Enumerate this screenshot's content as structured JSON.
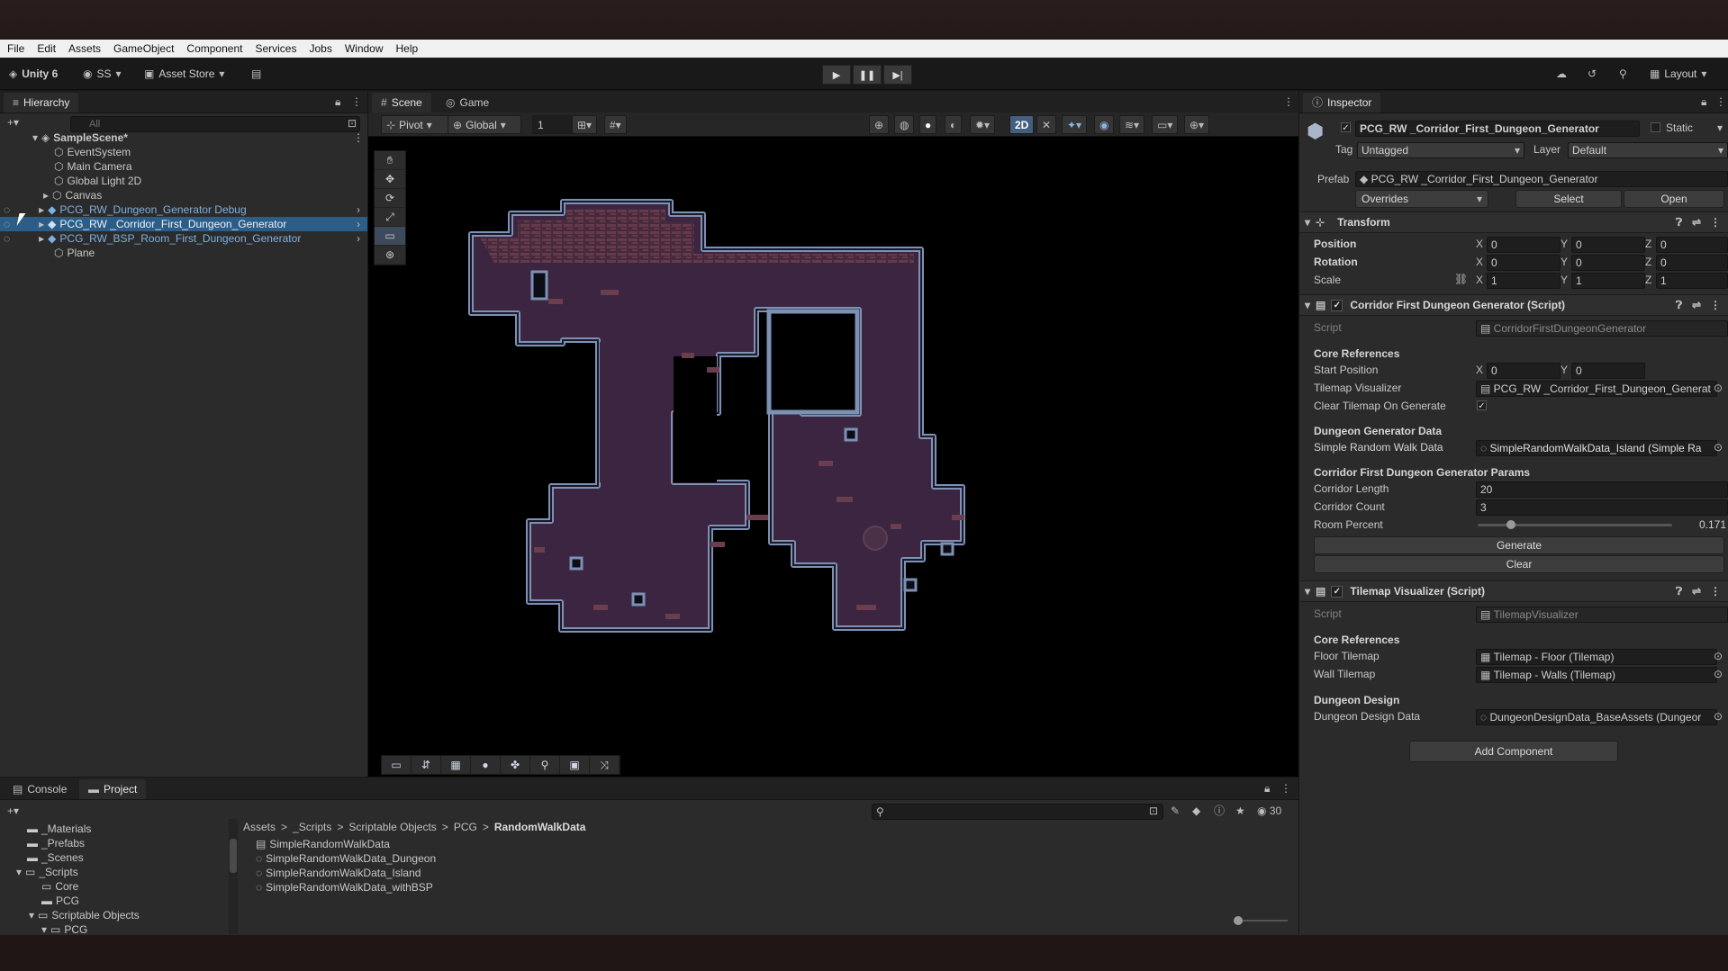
{
  "menu": [
    "File",
    "Edit",
    "Assets",
    "GameObject",
    "Component",
    "Services",
    "Jobs",
    "Window",
    "Help"
  ],
  "toolbar": {
    "unity_label": "Unity 6",
    "account_label": "SS",
    "asset_store_label": "Asset Store",
    "layout_label": "Layout"
  },
  "hierarchy": {
    "tab_label": "Hierarchy",
    "search_placeholder": "All",
    "scene_name": "SampleScene*",
    "items": [
      {
        "label": "EventSystem"
      },
      {
        "label": "Main Camera"
      },
      {
        "label": "Global Light 2D"
      },
      {
        "label": "Canvas"
      },
      {
        "label": "PCG_RW_Dungeon_Generator Debug"
      },
      {
        "label": "PCG_RW _Corridor_First_Dungeon_Generator"
      },
      {
        "label": "PCG_RW_BSP_Room_First_Dungeon_Generator"
      },
      {
        "label": "Plane"
      }
    ]
  },
  "scene_view": {
    "tabs": [
      "Scene",
      "Game"
    ],
    "pivot_label": "Pivot",
    "global_label": "Global",
    "snap_value": "1",
    "mode_2d": "2D"
  },
  "inspector": {
    "tab_label": "Inspector",
    "object_name": "PCG_RW _Corridor_First_Dungeon_Generator",
    "static_label": "Static",
    "tag_label": "Tag",
    "tag_value": "Untagged",
    "layer_label": "Layer",
    "layer_value": "Default",
    "prefab_label": "Prefab",
    "prefab_value": "PCG_RW _Corridor_First_Dungeon_Generator",
    "overrides_label": "Overrides",
    "select_label": "Select",
    "open_label": "Open",
    "transform": {
      "title": "Transform",
      "position_label": "Position",
      "rotation_label": "Rotation",
      "scale_label": "Scale",
      "position": [
        "0",
        "0",
        "0"
      ],
      "rotation": [
        "0",
        "0",
        "0"
      ],
      "scale": [
        "1",
        "1",
        "1"
      ],
      "axis": [
        "X",
        "Y",
        "Z"
      ]
    },
    "corridor_script": {
      "title": "Corridor First Dungeon Generator (Script)",
      "script_label": "Script",
      "script_value": "CorridorFirstDungeonGenerator",
      "core_refs_header": "Core References",
      "start_position_label": "Start Position",
      "start_position": [
        "0",
        "0"
      ],
      "tilemap_visualizer_label": "Tilemap Visualizer",
      "tilemap_visualizer_value": "PCG_RW _Corridor_First_Dungeon_Generat",
      "clear_on_generate_label": "Clear Tilemap On Generate",
      "data_header": "Dungeon Generator Data",
      "simple_rw_label": "Simple Random Walk Data",
      "simple_rw_value": "SimpleRandomWalkData_Island (Simple Ra",
      "params_header": "Corridor First Dungeon Generator Params",
      "corridor_length_label": "Corridor Length",
      "corridor_length": "20",
      "corridor_count_label": "Corridor Count",
      "corridor_count": "3",
      "room_percent_label": "Room Percent",
      "room_percent": "0.171",
      "room_percent_fraction": 0.171,
      "generate_label": "Generate",
      "clear_label": "Clear"
    },
    "tilemap_script": {
      "title": "Tilemap Visualizer (Script)",
      "script_label": "Script",
      "script_value": "TilemapVisualizer",
      "core_refs_header": "Core References",
      "floor_label": "Floor Tilemap",
      "floor_value": "Tilemap - Floor (Tilemap)",
      "wall_label": "Wall Tilemap",
      "wall_value": "Tilemap - Walls (Tilemap)",
      "design_header": "Dungeon Design",
      "design_label": "Dungeon Design Data",
      "design_value": "DungeonDesignData_BaseAssets (Dungeor"
    },
    "add_component_label": "Add Component"
  },
  "project": {
    "tabs": [
      "Console",
      "Project"
    ],
    "breadcrumb": [
      "Assets",
      "_Scripts",
      "Scriptable Objects",
      "PCG",
      "RandomWalkData"
    ],
    "tree": [
      {
        "label": "_Materials",
        "indent": 1
      },
      {
        "label": "_Prefabs",
        "indent": 1
      },
      {
        "label": "_Scenes",
        "indent": 1
      },
      {
        "label": "_Scripts",
        "indent": 1
      },
      {
        "label": "Core",
        "indent": 2
      },
      {
        "label": "PCG",
        "indent": 2
      },
      {
        "label": "Scriptable Objects",
        "indent": 2
      },
      {
        "label": "PCG",
        "indent": 3
      }
    ],
    "files": [
      "SimpleRandomWalkData",
      "SimpleRandomWalkData_Dungeon",
      "SimpleRandomWalkData_Island",
      "SimpleRandomWalkData_withBSP"
    ],
    "hidden_count": "30"
  }
}
